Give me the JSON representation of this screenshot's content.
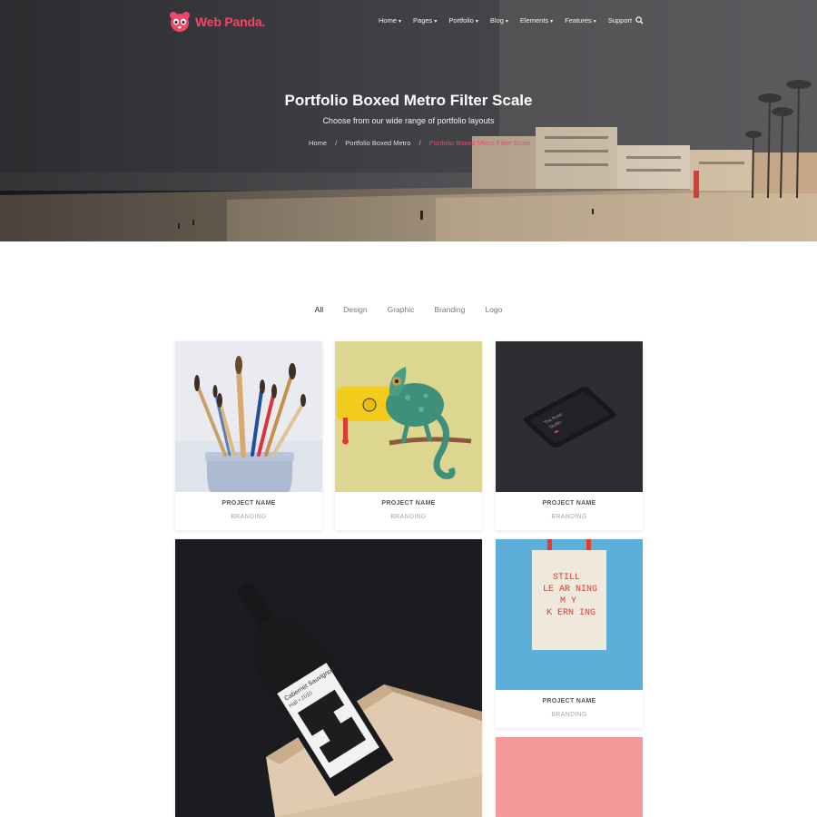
{
  "brand": {
    "name": "Web Panda.",
    "accent": "#f0476c"
  },
  "nav": {
    "items": [
      {
        "label": "Home",
        "dropdown": true
      },
      {
        "label": "Pages",
        "dropdown": true
      },
      {
        "label": "Portfolio",
        "dropdown": true
      },
      {
        "label": "Blog",
        "dropdown": true
      },
      {
        "label": "Elements",
        "dropdown": true
      },
      {
        "label": "Features",
        "dropdown": true
      },
      {
        "label": "Support",
        "dropdown": false
      }
    ],
    "search_icon": "search-icon"
  },
  "hero": {
    "title": "Portfolio Boxed Metro Filter Scale",
    "subtitle": "Choose from our wide range of portfolio layouts",
    "breadcrumb": [
      "Home",
      "Portfolio Boxed Metro",
      "Portfolio Boxed Metro Filter Scale"
    ]
  },
  "filters": [
    "All",
    "Design",
    "Graphic",
    "Branding",
    "Logo"
  ],
  "active_filter": "All",
  "projects": [
    {
      "name": "PROJECT NAME",
      "category": "BRANDING",
      "image": "paint-brushes-in-jar"
    },
    {
      "name": "PROJECT NAME",
      "category": "BRANDING",
      "image": "chameleon-on-yellow-toy"
    },
    {
      "name": "PROJECT NAME",
      "category": "BRANDING",
      "image": "phone-mockup-dark"
    },
    {
      "image": "wine-bottle-in-box"
    },
    {
      "name": "PROJECT NAME",
      "category": "BRANDING",
      "image": "tote-bag-lettering",
      "image_text": [
        "STILL",
        "LE AR NING",
        "M Y",
        "K ERN ING"
      ]
    },
    {
      "image": "pink-placeholder"
    }
  ],
  "wine_label": [
    "Cabernet Sauvignon",
    "Hall • 2010"
  ],
  "phone_screen_text": [
    "The Rose",
    "Studio"
  ]
}
